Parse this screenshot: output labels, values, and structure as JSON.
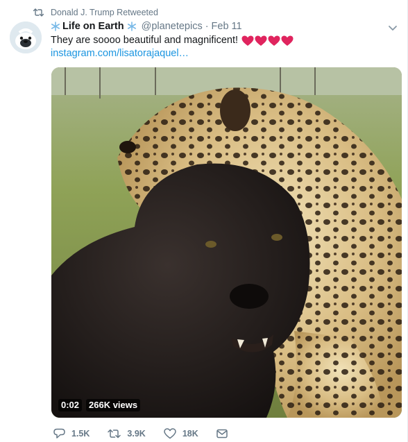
{
  "retweet": {
    "label": "Donald J. Trump Retweeted",
    "icon": "retweet-icon"
  },
  "author": {
    "name": "Life on Earth",
    "handle": "@planetepics",
    "separator": "·",
    "date": "Feb 11",
    "name_icons": [
      "snowflake-icon",
      "snowflake-icon"
    ]
  },
  "tweet": {
    "text": "They are soooo beautiful and magnificent!",
    "emoji": [
      "heart-emoji",
      "heart-emoji",
      "heart-emoji",
      "heart-emoji"
    ],
    "link": "instagram.com/lisatorajaquel…"
  },
  "video": {
    "duration": "0:02",
    "views": "266K views"
  },
  "actions": {
    "reply_count": "1.5K",
    "retweet_count": "3.9K",
    "like_count": "18K"
  },
  "colors": {
    "link": "#1b95e0",
    "muted": "#657786",
    "heart": "#e0245e",
    "snowflake": "#78b9e7"
  }
}
